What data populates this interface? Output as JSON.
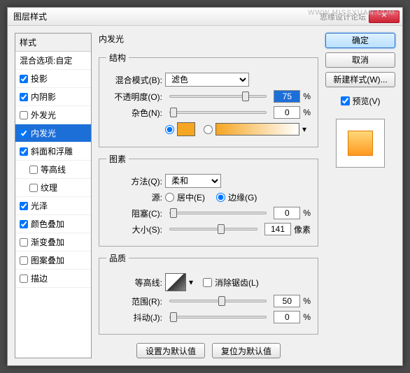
{
  "window": {
    "title": "图层样式",
    "forum": "思缘设计论坛",
    "watermark": "WWW.MISSYUAN.COM"
  },
  "sidebar": {
    "header": "样式",
    "blending": "混合选项:自定",
    "items": [
      {
        "label": "投影",
        "checked": true
      },
      {
        "label": "内阴影",
        "checked": true
      },
      {
        "label": "外发光",
        "checked": false
      },
      {
        "label": "内发光",
        "checked": true,
        "selected": true
      },
      {
        "label": "斜面和浮雕",
        "checked": true
      },
      {
        "label": "等高线",
        "checked": false,
        "sub": true
      },
      {
        "label": "纹理",
        "checked": false,
        "sub": true
      },
      {
        "label": "光泽",
        "checked": true
      },
      {
        "label": "颜色叠加",
        "checked": true
      },
      {
        "label": "渐变叠加",
        "checked": false
      },
      {
        "label": "图案叠加",
        "checked": false
      },
      {
        "label": "描边",
        "checked": false
      }
    ]
  },
  "center": {
    "title": "内发光",
    "structure": {
      "legend": "结构",
      "blendMode": {
        "label": "混合模式(B):",
        "value": "滤色"
      },
      "opacity": {
        "label": "不透明度(O):",
        "value": "75",
        "unit": "%",
        "pos": 75
      },
      "noise": {
        "label": "杂色(N):",
        "value": "0",
        "unit": "%",
        "pos": 0
      }
    },
    "elements": {
      "legend": "图素",
      "technique": {
        "label": "方法(Q):",
        "value": "柔和"
      },
      "source": {
        "label": "源:",
        "center": "居中(E)",
        "edge": "边缘(G)"
      },
      "choke": {
        "label": "阻塞(C):",
        "value": "0",
        "unit": "%",
        "pos": 0
      },
      "size": {
        "label": "大小(S):",
        "value": "141",
        "unit": "像素",
        "pos": 55
      }
    },
    "quality": {
      "legend": "品质",
      "contour": {
        "label": "等高线:",
        "antialias": "消除锯齿(L)"
      },
      "range": {
        "label": "范围(R):",
        "value": "50",
        "unit": "%",
        "pos": 50
      },
      "jitter": {
        "label": "抖动(J):",
        "value": "0",
        "unit": "%",
        "pos": 0
      }
    },
    "buttons": {
      "default": "设置为默认值",
      "reset": "复位为默认值"
    }
  },
  "right": {
    "ok": "确定",
    "cancel": "取消",
    "newStyle": "新建样式(W)...",
    "preview": "预览(V)"
  }
}
